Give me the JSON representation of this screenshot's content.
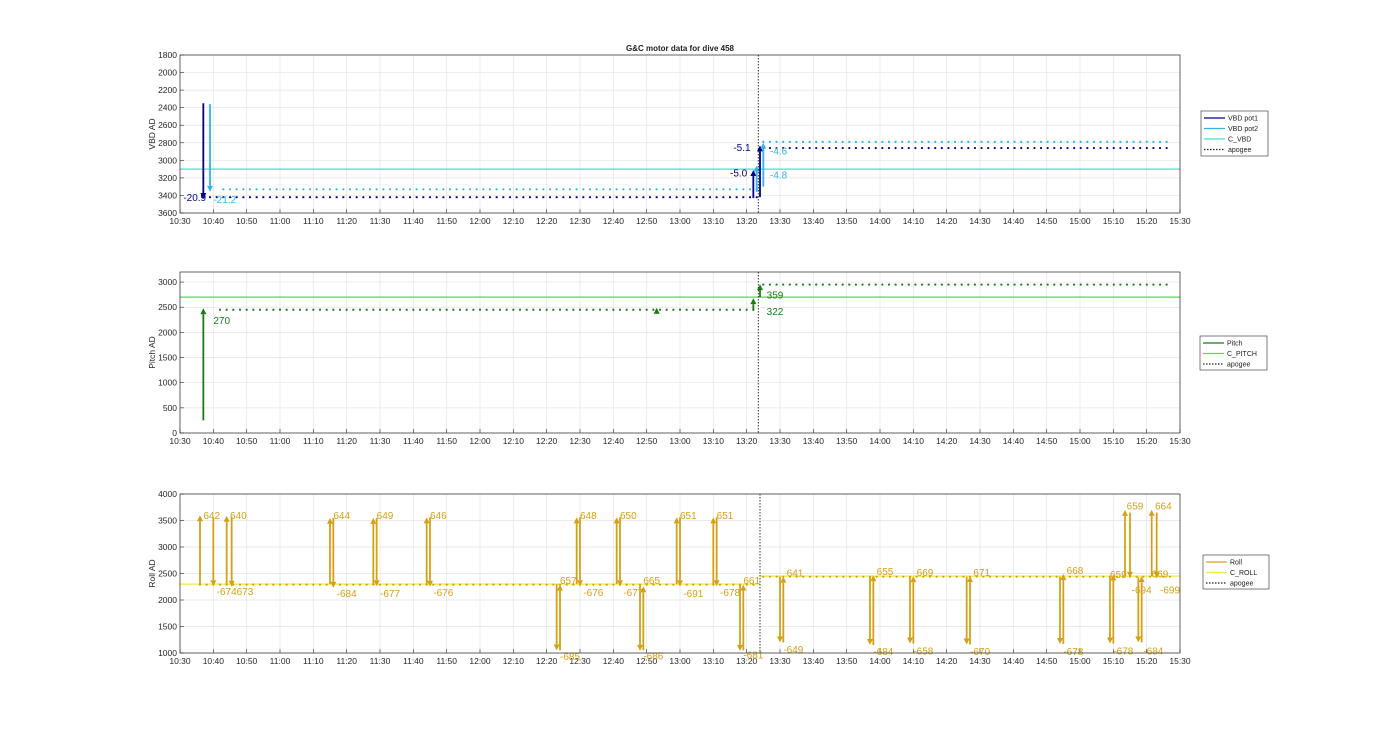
{
  "figure_title": "G&C motor data for dive 458",
  "chart_data": [
    {
      "type": "line",
      "id": "vbd",
      "title": "G&C motor data for dive 458",
      "ylabel": "VBD AD",
      "y_reversed": true,
      "ylim": [
        1800,
        3600
      ],
      "yticks": [
        1800,
        2000,
        2200,
        2400,
        2600,
        2800,
        3000,
        3200,
        3400,
        3600
      ],
      "xlim": [
        630,
        930
      ],
      "xticks": [
        "10:30",
        "10:40",
        "10:50",
        "11:00",
        "11:10",
        "11:20",
        "11:30",
        "11:40",
        "11:50",
        "12:00",
        "12:10",
        "12:20",
        "12:30",
        "12:40",
        "12:50",
        "13:00",
        "13:10",
        "13:20",
        "13:30",
        "13:40",
        "13:50",
        "14:00",
        "14:10",
        "14:20",
        "14:30",
        "14:40",
        "14:50",
        "15:00",
        "15:10",
        "15:20",
        "15:30"
      ],
      "apogee": 803.5,
      "grid": true,
      "legend_position": "outside-right",
      "legend": [
        {
          "name": "VBD pot1",
          "style": "solid",
          "color": "#00008b"
        },
        {
          "name": "VBD pot2",
          "style": "solid",
          "color": "#33b5e5"
        },
        {
          "name": "C_VBD",
          "style": "solid",
          "color": "#40e0d0"
        },
        {
          "name": "apogee",
          "style": "dotted",
          "color": "#222222"
        }
      ],
      "hlines": [
        {
          "name": "C_VBD",
          "y": 3100,
          "color": "#40e0d0"
        }
      ],
      "series": [
        {
          "name": "VBD pot1",
          "color": "#00008b",
          "segments": [
            {
              "x0": 637,
              "x1": 803,
              "y": 3420
            },
            {
              "x0": 805,
              "x1": 926,
              "y": 2860
            }
          ]
        },
        {
          "name": "VBD pot2",
          "color": "#33b5e5",
          "segments": [
            {
              "x0": 643,
              "x1": 803,
              "y": 3330
            },
            {
              "x0": 805,
              "x1": 926,
              "y": 2790
            }
          ]
        }
      ],
      "arrows": [
        {
          "x": 637,
          "y0": 2350,
          "y1": 3440,
          "color": "#00008b"
        },
        {
          "x": 639,
          "y0": 2360,
          "y1": 3360,
          "color": "#33b5e5"
        },
        {
          "x": 802,
          "y0": 3430,
          "y1": 3110,
          "color": "#00008b"
        },
        {
          "x": 804,
          "y0": 3420,
          "y1": 2830,
          "color": "#00008b"
        },
        {
          "x": 803,
          "y0": 3360,
          "y1": 3060,
          "color": "#33b5e5"
        },
        {
          "x": 805,
          "y0": 3300,
          "y1": 2800,
          "color": "#33b5e5"
        }
      ],
      "labels": [
        {
          "text": "-20.9",
          "x": 631,
          "y": 3420,
          "color": "#00008b"
        },
        {
          "text": "-21.2",
          "x": 640,
          "y": 3440,
          "color": "#33b5e5"
        },
        {
          "text": "-5.1",
          "x": 796,
          "y": 2850,
          "color": "#00008b"
        },
        {
          "text": "-4.6",
          "x": 807,
          "y": 2890,
          "color": "#33b5e5"
        },
        {
          "text": "-5.0",
          "x": 795,
          "y": 3140,
          "color": "#00008b"
        },
        {
          "text": "-4.8",
          "x": 807,
          "y": 3160,
          "color": "#33b5e5"
        }
      ]
    },
    {
      "type": "line",
      "id": "pitch",
      "ylabel": "Pitch AD",
      "ylim": [
        0,
        3200
      ],
      "yticks": [
        0,
        500,
        1000,
        1500,
        2000,
        2500,
        3000
      ],
      "xlim": [
        630,
        930
      ],
      "xticks": [
        "10:30",
        "10:40",
        "10:50",
        "11:00",
        "11:10",
        "11:20",
        "11:30",
        "11:40",
        "11:50",
        "12:00",
        "12:10",
        "12:20",
        "12:30",
        "12:40",
        "12:50",
        "13:00",
        "13:10",
        "13:20",
        "13:30",
        "13:40",
        "13:50",
        "14:00",
        "14:10",
        "14:20",
        "14:30",
        "14:40",
        "14:50",
        "15:00",
        "15:10",
        "15:20",
        "15:30"
      ],
      "apogee": 803.5,
      "grid": true,
      "legend_position": "outside-right",
      "legend": [
        {
          "name": "Pitch",
          "style": "solid",
          "color": "#1a7a1a"
        },
        {
          "name": "C_PITCH",
          "style": "solid",
          "color": "#5ad65a"
        },
        {
          "name": "apogee",
          "style": "dotted",
          "color": "#222222"
        }
      ],
      "hlines": [
        {
          "name": "C_PITCH",
          "y": 2700,
          "color": "#5ad65a"
        }
      ],
      "series": [
        {
          "name": "Pitch",
          "color": "#1a7a1a",
          "segments": [
            {
              "x0": 642,
              "x1": 802,
              "y": 2450
            },
            {
              "x0": 805,
              "x1": 926,
              "y": 2950
            }
          ]
        }
      ],
      "arrows": [
        {
          "x": 637,
          "y0": 250,
          "y1": 2480,
          "color": "#1a7a1a"
        },
        {
          "x": 773,
          "y0": 2440,
          "y1": 2490,
          "color": "#1a7a1a"
        },
        {
          "x": 802,
          "y0": 2440,
          "y1": 2680,
          "color": "#1a7a1a"
        },
        {
          "x": 804,
          "y0": 2700,
          "y1": 2960,
          "color": "#1a7a1a"
        }
      ],
      "labels": [
        {
          "text": "270",
          "x": 640,
          "y": 2250,
          "color": "#1a7a1a"
        },
        {
          "text": "359",
          "x": 806,
          "y": 2750,
          "color": "#1a7a1a"
        },
        {
          "text": "322",
          "x": 806,
          "y": 2420,
          "color": "#1a7a1a"
        }
      ]
    },
    {
      "type": "line",
      "id": "roll",
      "ylabel": "Roll AD",
      "ylim": [
        1000,
        4000
      ],
      "yticks": [
        1000,
        1500,
        2000,
        2500,
        3000,
        3500,
        4000
      ],
      "xlim": [
        630,
        930
      ],
      "xticks": [
        "10:30",
        "10:40",
        "10:50",
        "11:00",
        "11:10",
        "11:20",
        "11:30",
        "11:40",
        "11:50",
        "12:00",
        "12:10",
        "12:20",
        "12:30",
        "12:40",
        "12:50",
        "13:00",
        "13:10",
        "13:20",
        "13:30",
        "13:40",
        "13:50",
        "14:00",
        "14:10",
        "14:20",
        "14:30",
        "14:40",
        "14:50",
        "15:00",
        "15:10",
        "15:20",
        "15:30"
      ],
      "apogee": 804,
      "grid": true,
      "legend_position": "outside-right",
      "legend": [
        {
          "name": "Roll",
          "style": "solid",
          "color": "#d4a017"
        },
        {
          "name": "C_ROLL",
          "style": "solid",
          "color": "#f2ea3a"
        },
        {
          "name": "apogee",
          "style": "dotted",
          "color": "#222222"
        }
      ],
      "hlines": [
        {
          "name": "C_ROLL",
          "x0": 630,
          "x1": 804,
          "y": 2300,
          "color": "#f2ea3a"
        },
        {
          "name": "C_ROLL",
          "x0": 804,
          "x1": 930,
          "y": 2450,
          "color": "#f2ea3a"
        }
      ],
      "series": [
        {
          "name": "Roll",
          "color": "#d4a017",
          "segments": [
            {
              "x0": 636,
              "x1": 802,
              "y": 2290
            },
            {
              "x0": 805,
              "x1": 927,
              "y": 2440
            }
          ]
        }
      ],
      "arrows": [
        {
          "x": 636,
          "y0": 2300,
          "y1": 3600,
          "color": "#d4a017"
        },
        {
          "x": 640,
          "y0": 3550,
          "y1": 2260,
          "color": "#d4a017"
        },
        {
          "x": 644,
          "y0": 2290,
          "y1": 3590,
          "color": "#d4a017"
        },
        {
          "x": 645.5,
          "y0": 3570,
          "y1": 2250,
          "color": "#d4a017"
        },
        {
          "x": 675,
          "y0": 2300,
          "y1": 3550,
          "color": "#d4a017"
        },
        {
          "x": 676,
          "y0": 3550,
          "y1": 2230,
          "color": "#d4a017"
        },
        {
          "x": 688,
          "y0": 2300,
          "y1": 3550,
          "color": "#d4a017"
        },
        {
          "x": 689,
          "y0": 3550,
          "y1": 2260,
          "color": "#d4a017"
        },
        {
          "x": 704,
          "y0": 2300,
          "y1": 3560,
          "color": "#d4a017"
        },
        {
          "x": 705,
          "y0": 3560,
          "y1": 2250,
          "color": "#d4a017"
        },
        {
          "x": 743,
          "y0": 2300,
          "y1": 1050,
          "color": "#d4a017"
        },
        {
          "x": 744,
          "y0": 1050,
          "y1": 2290,
          "color": "#d4a017"
        },
        {
          "x": 749,
          "y0": 2300,
          "y1": 3560,
          "color": "#d4a017"
        },
        {
          "x": 750,
          "y0": 3560,
          "y1": 2260,
          "color": "#d4a017"
        },
        {
          "x": 761,
          "y0": 2300,
          "y1": 3560,
          "color": "#d4a017"
        },
        {
          "x": 762,
          "y0": 3560,
          "y1": 2260,
          "color": "#d4a017"
        },
        {
          "x": 768,
          "y0": 2300,
          "y1": 1040,
          "color": "#d4a017"
        },
        {
          "x": 769,
          "y0": 1050,
          "y1": 2260,
          "color": "#d4a017"
        },
        {
          "x": 779,
          "y0": 2300,
          "y1": 3560,
          "color": "#d4a017"
        },
        {
          "x": 780,
          "y0": 3560,
          "y1": 2260,
          "color": "#d4a017"
        },
        {
          "x": 790,
          "y0": 2300,
          "y1": 3560,
          "color": "#d4a017"
        },
        {
          "x": 791,
          "y0": 3560,
          "y1": 2260,
          "color": "#d4a017"
        },
        {
          "x": 798,
          "y0": 2300,
          "y1": 1040,
          "color": "#d4a017"
        },
        {
          "x": 799,
          "y0": 1050,
          "y1": 2290,
          "color": "#d4a017"
        },
        {
          "x": 810,
          "y0": 2440,
          "y1": 1200,
          "color": "#d4a017"
        },
        {
          "x": 811,
          "y0": 1200,
          "y1": 2440,
          "color": "#d4a017"
        },
        {
          "x": 837,
          "y0": 2440,
          "y1": 1150,
          "color": "#d4a017"
        },
        {
          "x": 838,
          "y0": 1150,
          "y1": 2470,
          "color": "#d4a017"
        },
        {
          "x": 849,
          "y0": 2440,
          "y1": 1180,
          "color": "#d4a017"
        },
        {
          "x": 850,
          "y0": 1180,
          "y1": 2450,
          "color": "#d4a017"
        },
        {
          "x": 866,
          "y0": 2440,
          "y1": 1160,
          "color": "#d4a017"
        },
        {
          "x": 867,
          "y0": 1160,
          "y1": 2450,
          "color": "#d4a017"
        },
        {
          "x": 894,
          "y0": 2440,
          "y1": 1170,
          "color": "#d4a017"
        },
        {
          "x": 895,
          "y0": 1170,
          "y1": 2490,
          "color": "#d4a017"
        },
        {
          "x": 909,
          "y0": 2440,
          "y1": 1180,
          "color": "#d4a017"
        },
        {
          "x": 910,
          "y0": 1180,
          "y1": 2480,
          "color": "#d4a017"
        },
        {
          "x": 913.5,
          "y0": 2450,
          "y1": 3700,
          "color": "#d4a017"
        },
        {
          "x": 915,
          "y0": 3650,
          "y1": 2420,
          "color": "#d4a017"
        },
        {
          "x": 917.5,
          "y0": 2430,
          "y1": 1200,
          "color": "#d4a017"
        },
        {
          "x": 918.5,
          "y0": 1200,
          "y1": 2450,
          "color": "#d4a017"
        },
        {
          "x": 921.5,
          "y0": 2450,
          "y1": 3700,
          "color": "#d4a017"
        },
        {
          "x": 923,
          "y0": 3650,
          "y1": 2420,
          "color": "#d4a017"
        }
      ],
      "labels": [
        {
          "text": "642",
          "x": 637,
          "y": 3600,
          "color": "#d4a017"
        },
        {
          "text": "-674",
          "x": 641,
          "y": 2170,
          "color": "#d4a017"
        },
        {
          "text": "640",
          "x": 645,
          "y": 3600,
          "color": "#d4a017"
        },
        {
          "text": "673",
          "x": 647,
          "y": 2170,
          "color": "#d4a017"
        },
        {
          "text": "644",
          "x": 676,
          "y": 3600,
          "color": "#d4a017"
        },
        {
          "text": "-684",
          "x": 677,
          "y": 2130,
          "color": "#d4a017"
        },
        {
          "text": "649",
          "x": 689,
          "y": 3600,
          "color": "#d4a017"
        },
        {
          "text": "-677",
          "x": 690,
          "y": 2130,
          "color": "#d4a017"
        },
        {
          "text": "646",
          "x": 705,
          "y": 3600,
          "color": "#d4a017"
        },
        {
          "text": "-676",
          "x": 706,
          "y": 2150,
          "color": "#d4a017"
        },
        {
          "text": "657",
          "x": 744,
          "y": 2380,
          "color": "#d4a017"
        },
        {
          "text": "-685",
          "x": 744,
          "y": 940,
          "color": "#d4a017"
        },
        {
          "text": "648",
          "x": 750,
          "y": 3600,
          "color": "#d4a017"
        },
        {
          "text": "-676",
          "x": 751,
          "y": 2150,
          "color": "#d4a017"
        },
        {
          "text": "650",
          "x": 762,
          "y": 3600,
          "color": "#d4a017"
        },
        {
          "text": "-677",
          "x": 763,
          "y": 2150,
          "color": "#d4a017"
        },
        {
          "text": "665",
          "x": 769,
          "y": 2380,
          "color": "#d4a017"
        },
        {
          "text": "-686",
          "x": 769,
          "y": 950,
          "color": "#d4a017"
        },
        {
          "text": "651",
          "x": 780,
          "y": 3600,
          "color": "#d4a017"
        },
        {
          "text": "-691",
          "x": 781,
          "y": 2130,
          "color": "#d4a017"
        },
        {
          "text": "651",
          "x": 791,
          "y": 3600,
          "color": "#d4a017"
        },
        {
          "text": "-678",
          "x": 792,
          "y": 2150,
          "color": "#d4a017"
        },
        {
          "text": "661",
          "x": 799,
          "y": 2380,
          "color": "#d4a017"
        },
        {
          "text": "-681",
          "x": 799,
          "y": 970,
          "color": "#d4a017"
        },
        {
          "text": "641",
          "x": 812,
          "y": 2520,
          "color": "#d4a017"
        },
        {
          "text": "-649",
          "x": 811,
          "y": 1080,
          "color": "#d4a017"
        },
        {
          "text": "655",
          "x": 839,
          "y": 2550,
          "color": "#d4a017"
        },
        {
          "text": "-684",
          "x": 838,
          "y": 1040,
          "color": "#d4a017"
        },
        {
          "text": "669",
          "x": 851,
          "y": 2530,
          "color": "#d4a017"
        },
        {
          "text": "-658",
          "x": 850,
          "y": 1050,
          "color": "#d4a017"
        },
        {
          "text": "671",
          "x": 868,
          "y": 2530,
          "color": "#d4a017"
        },
        {
          "text": "-670",
          "x": 867,
          "y": 1040,
          "color": "#d4a017"
        },
        {
          "text": "668",
          "x": 896,
          "y": 2570,
          "color": "#d4a017"
        },
        {
          "text": "-678",
          "x": 895,
          "y": 1040,
          "color": "#d4a017"
        },
        {
          "text": "659",
          "x": 909,
          "y": 2490,
          "color": "#d4a017"
        },
        {
          "text": "-678",
          "x": 910,
          "y": 1050,
          "color": "#d4a017"
        },
        {
          "text": "659",
          "x": 914,
          "y": 3780,
          "color": "#d4a017"
        },
        {
          "text": "-694",
          "x": 915.5,
          "y": 2200,
          "color": "#d4a017"
        },
        {
          "text": "-684",
          "x": 919,
          "y": 1050,
          "color": "#d4a017"
        },
        {
          "text": "664",
          "x": 922.5,
          "y": 3780,
          "color": "#d4a017"
        },
        {
          "text": "669",
          "x": 921.5,
          "y": 2500,
          "color": "#d4a017"
        },
        {
          "text": "-699",
          "x": 924,
          "y": 2200,
          "color": "#d4a017"
        }
      ]
    }
  ]
}
